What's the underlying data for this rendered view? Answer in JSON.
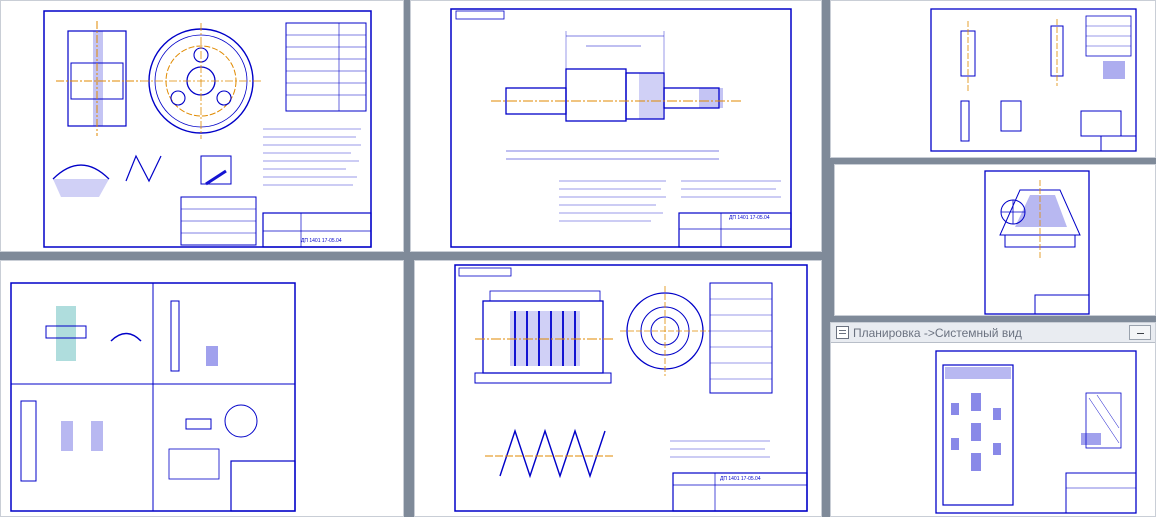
{
  "colors": {
    "background": "#7f8a99",
    "sheet": "#ffffff",
    "drawing_line": "#0000c8",
    "center_line": "#e08a00",
    "fill_accent": "#1414d2",
    "titlebar_text": "#6b7280"
  },
  "windows": {
    "active_window": {
      "title": "Планировка ->Системный вид",
      "icon": "drawing-window-icon",
      "minimize_icon": "minimize-icon"
    }
  },
  "sheets": {
    "worm_wheel": {
      "stamp_code": "ДП 1401 17-05.04"
    },
    "shaft": {
      "stamp_code": "ДП 1401 17-05.04"
    },
    "worm": {
      "stamp_code": "ДП 1401 17-05.04"
    }
  }
}
